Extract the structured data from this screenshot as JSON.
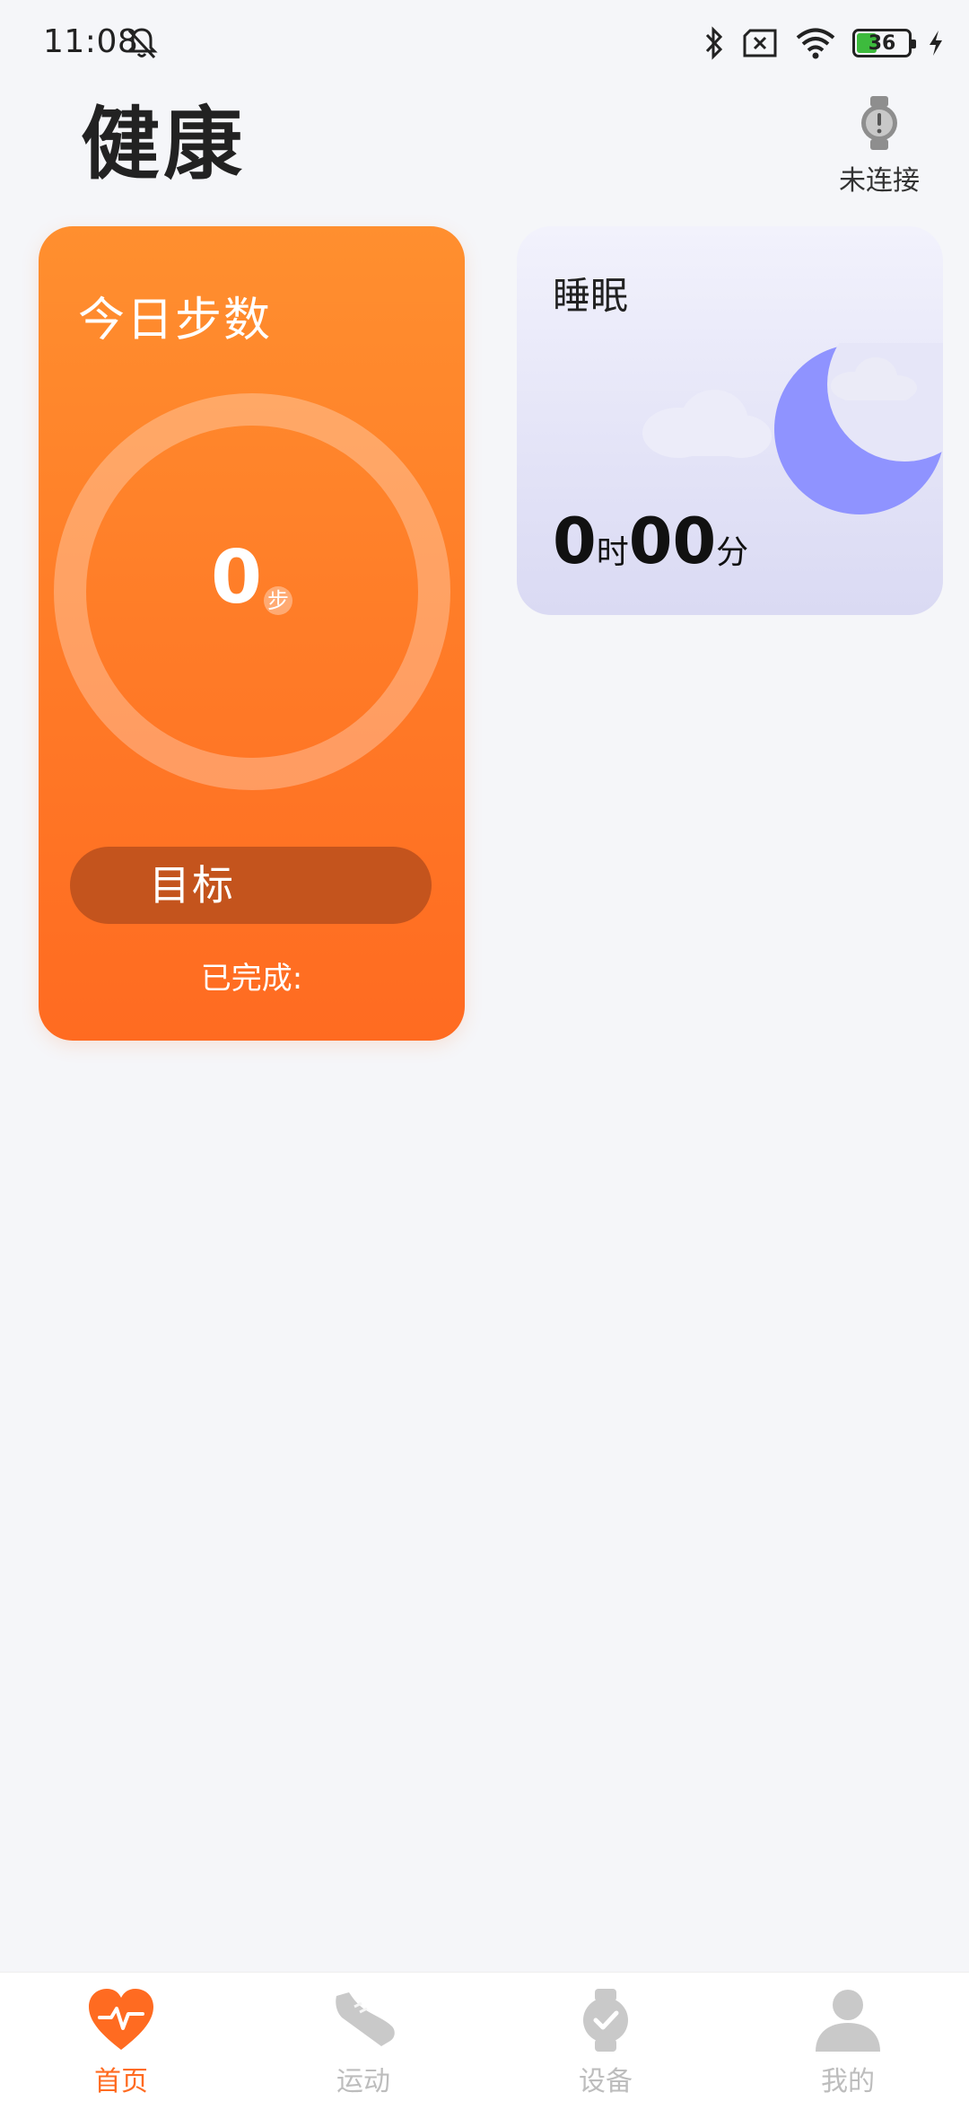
{
  "status_bar": {
    "time": "11:08",
    "battery_level": "36",
    "icons": [
      "bell-off-icon",
      "bluetooth-icon",
      "no-sim-icon",
      "wifi-icon",
      "battery-icon",
      "charging-icon"
    ]
  },
  "header": {
    "title": "健康",
    "device_status": "未连接",
    "device_icon": "watch-icon"
  },
  "steps_card": {
    "title": "今日步数",
    "value": "0",
    "unit": "步",
    "goal_label": "目标",
    "completed_label": "已完成:",
    "progress": 0
  },
  "sleep_card": {
    "title": "睡眠",
    "hours": "0",
    "hours_unit": "时",
    "minutes": "00",
    "minutes_unit": "分"
  },
  "bottom_nav": {
    "items": [
      {
        "label": "首页",
        "icon": "heart-pulse-icon",
        "active": true
      },
      {
        "label": "运动",
        "icon": "sneaker-icon",
        "active": false
      },
      {
        "label": "设备",
        "icon": "watch-check-icon",
        "active": false
      },
      {
        "label": "我的",
        "icon": "person-icon",
        "active": false
      }
    ]
  },
  "colors": {
    "accent": "#ff6b21",
    "steps_gradient_top": "#ff8f2f",
    "goal_button": "#c4541d",
    "moon": "#8f93ff",
    "inactive_nav": "#bdbdbd",
    "background": "#f5f6f9"
  }
}
